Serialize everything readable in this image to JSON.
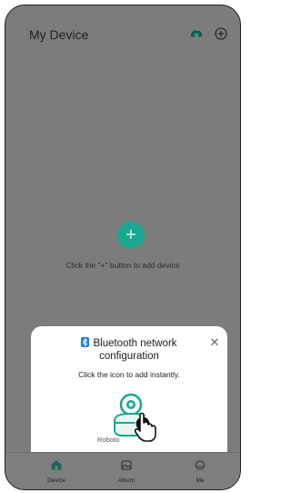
{
  "header": {
    "title": "My Device",
    "cloud_icon": "cloud-device-icon",
    "add_icon": "plus-circle-icon"
  },
  "main": {
    "add_button_icon": "plus-icon",
    "empty_hint": "Click the \"+\" button to add device"
  },
  "modal": {
    "badge_icon": "bluetooth-icon",
    "title_line1": "Bluetooth network",
    "title_line2": "configuration",
    "close_icon": "close-icon",
    "subtitle": "Click the icon to add instantly.",
    "device_label": "Roboto",
    "device_icon": "robot-device-icon",
    "hand_icon": "pointer-hand-icon"
  },
  "nav": {
    "items": [
      {
        "label": "Device",
        "icon": "home-icon",
        "active": true
      },
      {
        "label": "Album",
        "icon": "album-icon",
        "active": false
      },
      {
        "label": "Me",
        "icon": "profile-icon",
        "active": false
      }
    ]
  },
  "colors": {
    "accent": "#1aa78f",
    "bluetooth": "#1e7ed8",
    "overlay": "#7c7c7c"
  }
}
